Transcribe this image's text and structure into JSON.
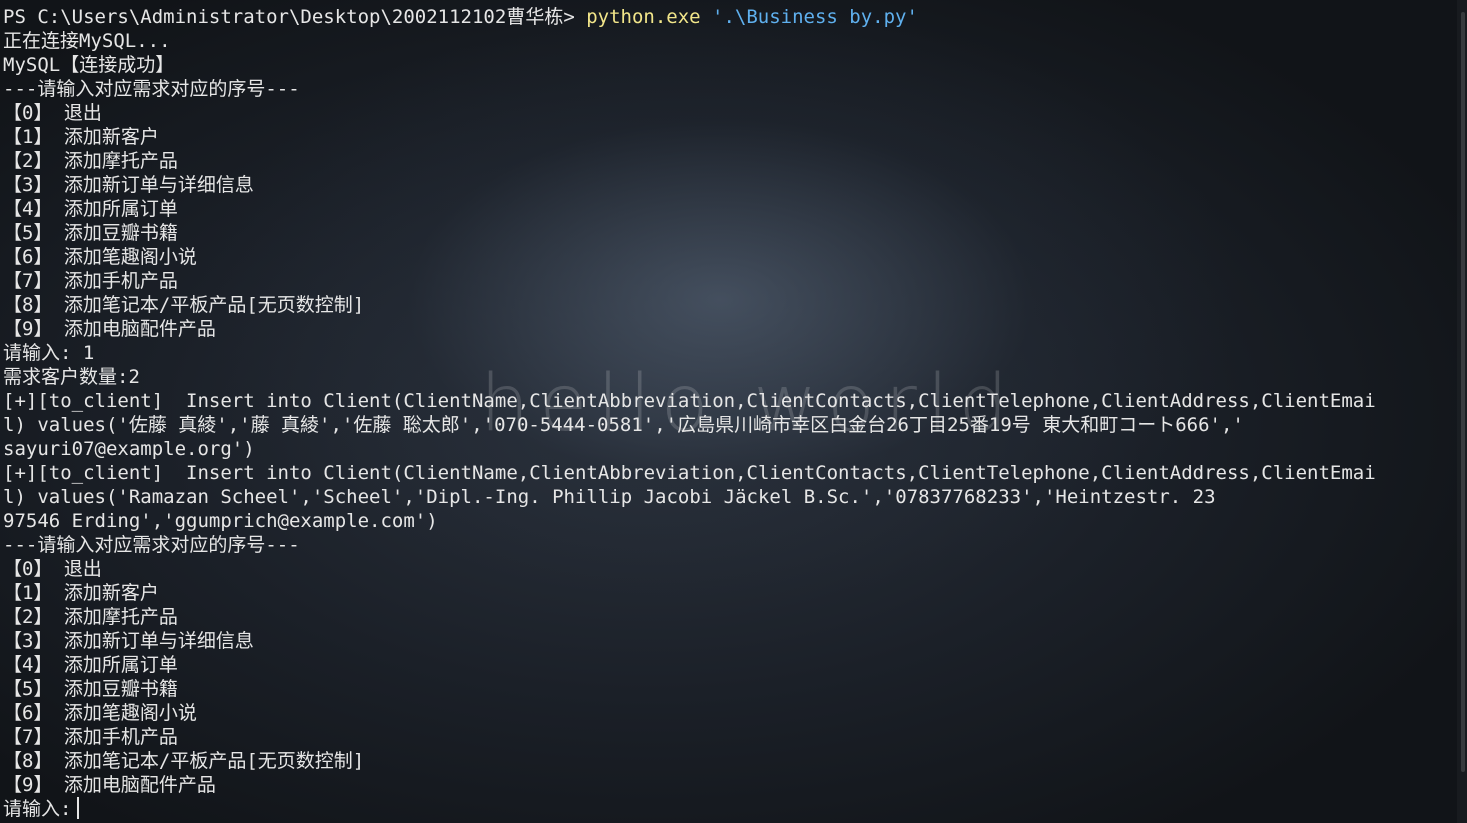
{
  "watermark": "hello world",
  "prompt": {
    "ps": "PS C:\\Users\\Administrator\\Desktop\\2002112102曹华栋> ",
    "exe": "python.exe",
    "arg": " '.\\Business by.py'"
  },
  "lines": [
    "正在连接MySQL...",
    "MySQL【连接成功】",
    "---请输入对应需求对应的序号---",
    "【0】 退出",
    "【1】 添加新客户",
    "【2】 添加摩托产品",
    "【3】 添加新订单与详细信息",
    "【4】 添加所属订单",
    "【5】 添加豆瓣书籍",
    "【6】 添加笔趣阁小说",
    "【7】 添加手机产品",
    "【8】 添加笔记本/平板产品[无页数控制]",
    "【9】 添加电脑配件产品",
    "请输入: 1",
    "需求客户数量:2",
    "[+][to_client]  Insert into Client(ClientName,ClientAbbreviation,ClientContacts,ClientTelephone,ClientAddress,ClientEmai",
    "l) values('佐藤 真綾','藤 真綾','佐藤 聡太郎','070-5444-0581','広島県川崎市幸区白金台26丁目25番19号 東大和町コート666','",
    "sayuri07@example.org')",
    "[+][to_client]  Insert into Client(ClientName,ClientAbbreviation,ClientContacts,ClientTelephone,ClientAddress,ClientEmai",
    "l) values('Ramazan Scheel','Scheel','Dipl.-Ing. Phillip Jacobi Jäckel B.Sc.','07837768233','Heintzestr. 23",
    "97546 Erding','ggumprich@example.com')",
    "---请输入对应需求对应的序号---",
    "【0】 退出",
    "【1】 添加新客户",
    "【2】 添加摩托产品",
    "【3】 添加新订单与详细信息",
    "【4】 添加所属订单",
    "【5】 添加豆瓣书籍",
    "【6】 添加笔趣阁小说",
    "【7】 添加手机产品",
    "【8】 添加笔记本/平板产品[无页数控制]",
    "【9】 添加电脑配件产品"
  ],
  "input_prompt": "请输入:"
}
